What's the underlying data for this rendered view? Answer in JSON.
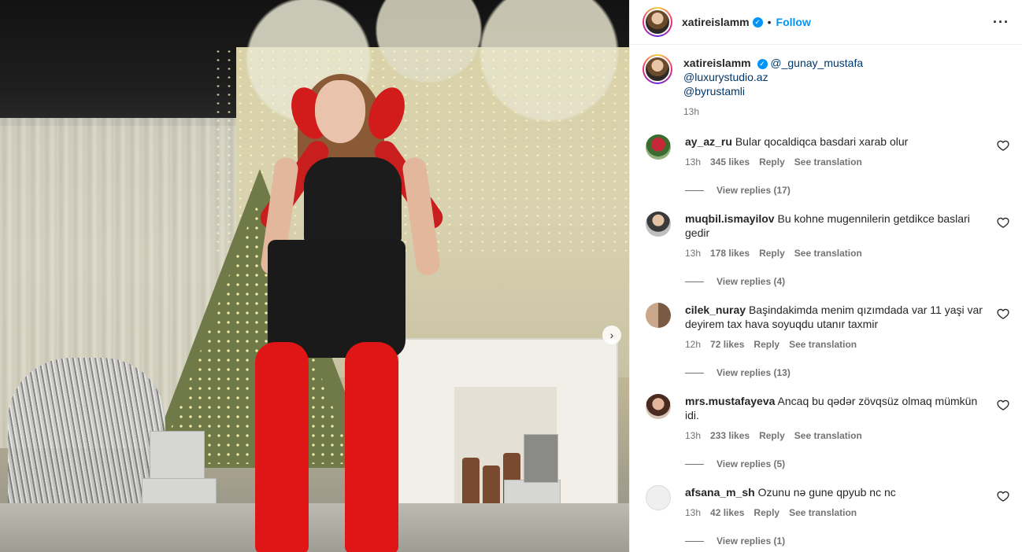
{
  "post": {
    "author": {
      "username": "xatireislamm",
      "verified": true,
      "follow_label": "Follow",
      "more_icon": "more-horizontal-icon"
    },
    "caption": {
      "username": "xatireislamm",
      "mentions": [
        "@_gunay_mustafa",
        "@luxurystudio.az",
        "@byrustamli"
      ],
      "time": "13h"
    },
    "media": {
      "next_icon": "chevron-right-icon",
      "next_label": "›"
    },
    "comments": [
      {
        "username": "ay_az_ru",
        "text": "Bular qocaldiqca basdari xarab olur",
        "time": "13h",
        "likes": "345 likes",
        "reply_label": "Reply",
        "translate_label": "See translation",
        "replies_label": "View replies (17)"
      },
      {
        "username": "muqbil.ismayilov",
        "text": "Bu kohne mugennilerin getdikce baslari gedir",
        "time": "13h",
        "likes": "178 likes",
        "reply_label": "Reply",
        "translate_label": "See translation",
        "replies_label": "View replies (4)"
      },
      {
        "username": "cilek_nuray",
        "text": "Başindakimda menim qızımdada var 11 yaşi var deyirem tax hava soyuqdu utanır taxmir",
        "time": "12h",
        "likes": "72 likes",
        "reply_label": "Reply",
        "translate_label": "See translation",
        "replies_label": "View replies (13)"
      },
      {
        "username": "mrs.mustafayeva",
        "text": "Ancaq bu qədər zövqsüz olmaq mümkün idi.",
        "time": "13h",
        "likes": "233 likes",
        "reply_label": "Reply",
        "translate_label": "See translation",
        "replies_label": "View replies (5)"
      },
      {
        "username": "afsana_m_sh",
        "text": "Ozunu nə gune qpyub nc nc",
        "time": "13h",
        "likes": "42 likes",
        "reply_label": "Reply",
        "translate_label": "See translation",
        "replies_label": "View replies (1)"
      }
    ]
  },
  "colors": {
    "link_blue": "#0095f6",
    "mention_blue": "#00376b",
    "muted_text": "#737373",
    "primary_text": "#262626",
    "divider": "#efefef"
  },
  "icons": {
    "verified": "verified-badge-icon",
    "heart": "heart-outline-icon"
  }
}
